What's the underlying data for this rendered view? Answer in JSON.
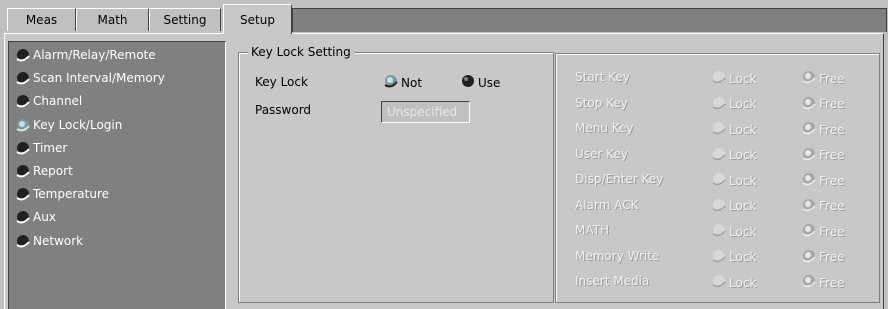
{
  "tabs": [
    {
      "label": "Meas"
    },
    {
      "label": "Math"
    },
    {
      "label": "Setting"
    },
    {
      "label": "Setup"
    }
  ],
  "sidebar": {
    "items": [
      {
        "label": "Alarm/Relay/Remote"
      },
      {
        "label": "Scan Interval/Memory"
      },
      {
        "label": "Channel"
      },
      {
        "label": "Key Lock/Login"
      },
      {
        "label": "Timer"
      },
      {
        "label": "Report"
      },
      {
        "label": "Temperature"
      },
      {
        "label": "Aux"
      },
      {
        "label": "Network"
      }
    ],
    "selected_index": 3
  },
  "keylock": {
    "title": "Key Lock Setting",
    "key_lock_label": "Key Lock",
    "not_label": "Not",
    "use_label": "Use",
    "selected": "Not",
    "password_label": "Password",
    "password_value": "Unspecified"
  },
  "keys": {
    "lock_label": "Lock",
    "free_label": "Free",
    "rows": [
      {
        "label": "Start Key"
      },
      {
        "label": "Stop Key"
      },
      {
        "label": "Menu Key"
      },
      {
        "label": "User Key"
      },
      {
        "label": "Disp/Enter Key"
      },
      {
        "label": "Alarm ACK"
      },
      {
        "label": "MATH"
      },
      {
        "label": "Memory Write"
      },
      {
        "label": "Insert Media"
      }
    ]
  },
  "colors": {
    "sidebar_bg": "#808080",
    "tabbar_fill": "#808080",
    "panel_bg": "#c8c8c8",
    "disabled_text": "#f2f2f2"
  }
}
